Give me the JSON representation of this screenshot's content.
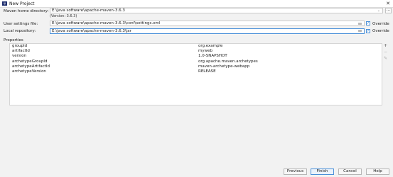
{
  "window": {
    "title": "New Project",
    "icon_text": "IJ"
  },
  "form": {
    "maven_home": {
      "label": "Maven home directory:",
      "value": "E:\\java software\\apache-maven-3.6.3",
      "version_note": "(Version: 3.6.3)"
    },
    "user_settings": {
      "label": "User settings file:",
      "value": "E:\\java software\\apache-maven-3.6.3\\conf\\settings.xml",
      "override_label": "Override"
    },
    "local_repo": {
      "label": "Local repository:",
      "value": "E:\\java software\\apache-maven-3.6.3\\jar",
      "override_label": "Override"
    }
  },
  "properties": {
    "title": "Properties",
    "rows": [
      {
        "key": "groupId",
        "value": "org.example"
      },
      {
        "key": "artifactId",
        "value": "myweb"
      },
      {
        "key": "version",
        "value": "1.0-SNAPSHOT"
      },
      {
        "key": "archetypeGroupId",
        "value": "org.apache.maven.archetypes"
      },
      {
        "key": "archetypeArtifactId",
        "value": "maven-archetype-webapp"
      },
      {
        "key": "archetypeVersion",
        "value": "RELEASE"
      }
    ]
  },
  "buttons": {
    "previous": "Previous",
    "finish": "Finish",
    "cancel": "Cancel",
    "help": "Help"
  },
  "glyphs": {
    "close": "✕",
    "dropdown": "⌄",
    "dots": "...",
    "check": "✓",
    "add": "+",
    "remove": "−",
    "edit": "✎"
  }
}
